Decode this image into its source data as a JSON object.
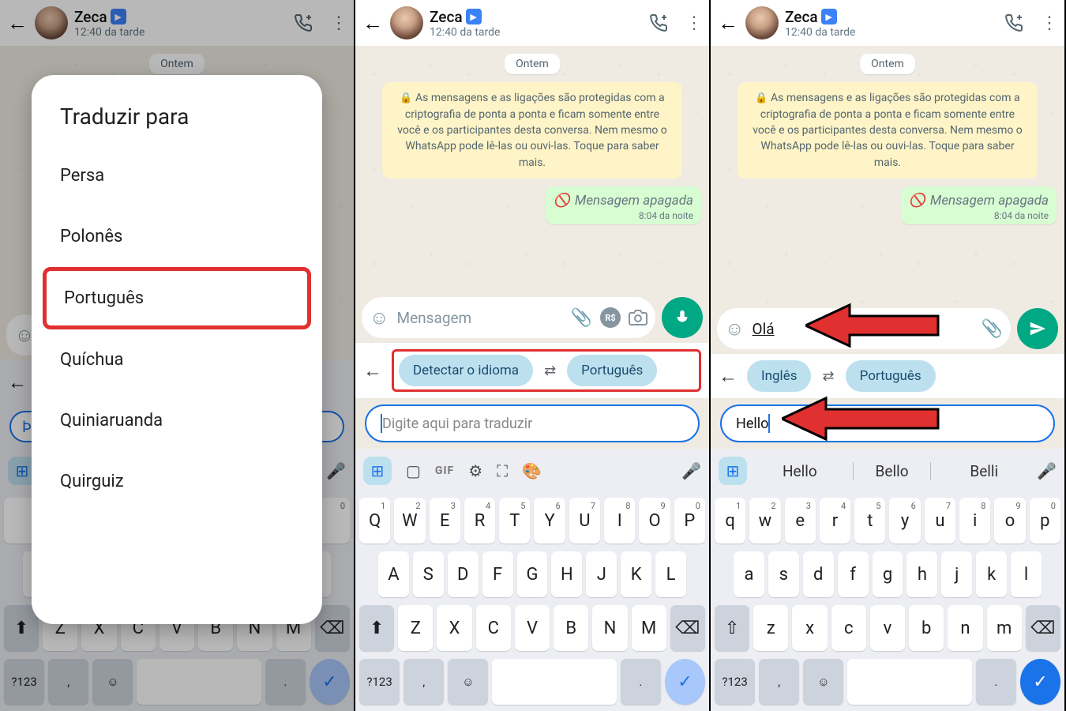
{
  "header": {
    "name": "Zeca",
    "time": "12:40 da tarde"
  },
  "chat": {
    "date": "Ontem",
    "encryption": "As mensagens e as ligações são protegidas com a criptografia de ponta a ponta e ficam somente entre você e os participantes desta conversa. Nem mesmo o WhatsApp pode lê-las ou ouvi-las. Toque para saber mais.",
    "deleted": "Mensagem apagada",
    "deleted_time": "8:04 da noite"
  },
  "input": {
    "placeholder": "Mensagem",
    "typed_p3": "Olá"
  },
  "translate": {
    "detect": "Detectar o idioma",
    "target": "Português",
    "source_p3": "Inglês",
    "input_ph": "Digite aqui para traduzir",
    "input_val_p3": "Hello"
  },
  "modal": {
    "title": "Traduzir para",
    "items": [
      "Persa",
      "Polonês",
      "Português",
      "Quíchua",
      "Quiniaruanda",
      "Quirguiz"
    ],
    "highlight": "Português"
  },
  "suggestions_p3": [
    "Hello",
    "Bello",
    "Belli"
  ],
  "kb": {
    "upper_r1": [
      "Q",
      "W",
      "E",
      "R",
      "T",
      "Y",
      "U",
      "I",
      "O",
      "P"
    ],
    "upper_nums": [
      "1",
      "2",
      "3",
      "4",
      "5",
      "6",
      "7",
      "8",
      "9",
      "0"
    ],
    "upper_r2": [
      "A",
      "S",
      "D",
      "F",
      "G",
      "H",
      "J",
      "K",
      "L"
    ],
    "upper_r3": [
      "Z",
      "X",
      "C",
      "V",
      "B",
      "N",
      "M"
    ],
    "lower_r1": [
      "q",
      "w",
      "e",
      "r",
      "t",
      "y",
      "u",
      "i",
      "o",
      "p"
    ],
    "lower_r2": [
      "a",
      "s",
      "d",
      "f",
      "g",
      "h",
      "j",
      "k",
      "l"
    ],
    "lower_r3": [
      "z",
      "x",
      "c",
      "v",
      "b",
      "n",
      "m"
    ],
    "sym": "?123",
    "comma": ",",
    "period": "."
  },
  "tools_gif": "GIF"
}
